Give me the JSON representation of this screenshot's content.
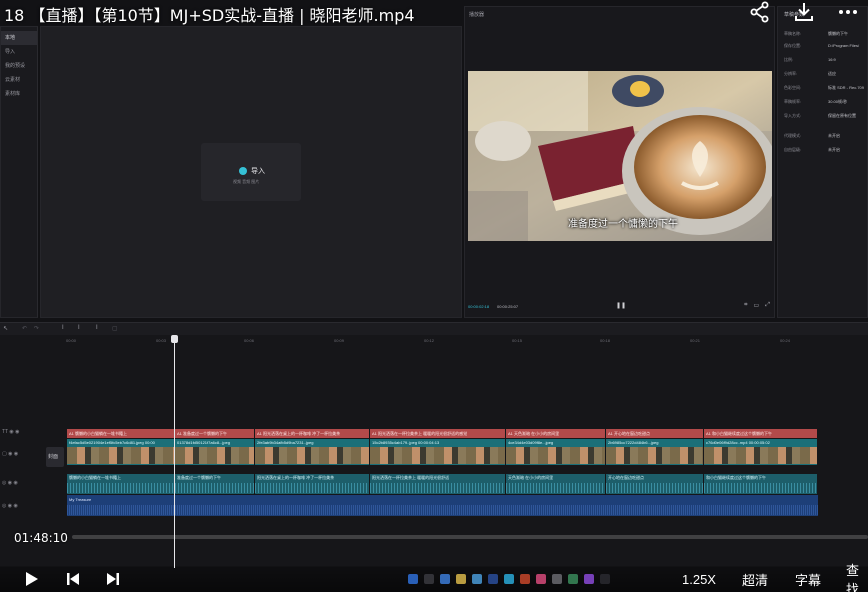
{
  "player": {
    "title": "18 【直播】【第10节】MJ+SD实战-直播 | 晓阳老师.mp4",
    "current_time": "01:48:10",
    "progress": 0.0,
    "speed": "1.25X",
    "quality": "超清",
    "subtitle_btn": "字幕",
    "search_btn": "查找"
  },
  "sidebar": {
    "items": [
      {
        "label": "本地",
        "active": true
      },
      {
        "label": "导入",
        "active": false
      },
      {
        "label": "我的预设",
        "active": false
      },
      {
        "label": "云素材",
        "active": false
      },
      {
        "label": "素材库",
        "active": false
      }
    ]
  },
  "media": {
    "import_label": "导入",
    "import_sub": "视频 音频 图片"
  },
  "preview": {
    "label": "播放器",
    "subtitle": "准备度过一个慵懒的下午",
    "timecode_current": "00:00:02:18",
    "timecode_total": "00:00:25:07"
  },
  "props": {
    "header": "草稿参数",
    "rows": [
      {
        "k": "草稿名称:",
        "v": "慵懒的下午"
      },
      {
        "k": "保存位置:",
        "v": "D:/Program Files/"
      },
      {
        "k": "比例:",
        "v": "16:9"
      },
      {
        "k": "分辨率:",
        "v": "适应"
      },
      {
        "k": "色彩空间:",
        "v": "标准 SDR - Rec.709"
      },
      {
        "k": "草稿帧率:",
        "v": "30.00帧/秒"
      },
      {
        "k": "导入方式:",
        "v": "保留在原有位置"
      },
      {
        "k": "代理模式:",
        "v": "未开启"
      },
      {
        "k": "自由层级:",
        "v": "未开启"
      }
    ]
  },
  "timeline": {
    "ruler": [
      "00:00",
      "00:03",
      "00:06",
      "00:09",
      "00:12",
      "00:15",
      "00:18",
      "00:21",
      "00:24"
    ],
    "cover_label": "封面",
    "text_clips": [
      {
        "label": "A1 慵懒的小白猫躺在一堆书籍上"
      },
      {
        "label": "A1 准备度过一个慵懒的下午"
      },
      {
        "label": "A1 阳光洒落在桌上的一杯咖啡 冲了一杯拉美茶"
      },
      {
        "label": "A1 阳光洒落在一杯拉美茶上 暖暖的阳光很舒适的感觉"
      },
      {
        "label": "A1 天色渐暗 在小小的房间里"
      },
      {
        "label": "A1 开心地在窗边吃甜点"
      },
      {
        "label": "A1 和小白猫继续度过这个慵懒的下午"
      }
    ],
    "video_clips": [
      {
        "label": "f4efac5d5e021904e1ef5fc5eb7c6d81.jpeg 00:00"
      },
      {
        "label": "01378d1fd50121f7a6c8...jpeg"
      },
      {
        "label": "2fe3ab9b34afb5d9ba7231..jpeg"
      },
      {
        "label": "15c2b8935c4ab179..jpeg 00:00:04:13"
      },
      {
        "label": "4ce34d4e03d09f8e...jpeg"
      },
      {
        "label": "2b6985cc7222d484b6...jpeg"
      },
      {
        "label": "c76d0e06f9d28cc..mp4 00:00:05:02"
      }
    ],
    "audio_clips": [
      {
        "label": "慵懒的小白猫躺在一堆书籍上"
      },
      {
        "label": "准备度过一个慵懒的下午"
      },
      {
        "label": "阳光洒落在桌上的一杯咖啡 冲了一杯拉美茶"
      },
      {
        "label": "阳光洒落在一杯拉美茶上 暖暖的阳光很舒适"
      },
      {
        "label": "天色渐暗 在小小的房间里"
      },
      {
        "label": "开心地在窗边吃甜点"
      },
      {
        "label": "和小白猫继续度过这个慵懒的下午"
      }
    ],
    "music_label": "My Treasure"
  }
}
